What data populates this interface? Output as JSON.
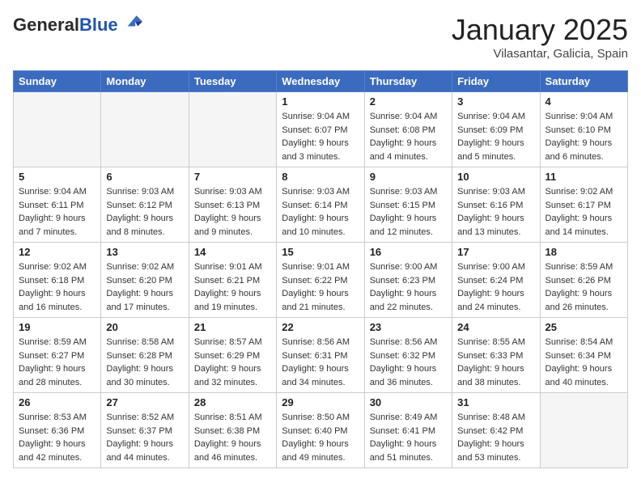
{
  "header": {
    "logo_general": "General",
    "logo_blue": "Blue",
    "month_title": "January 2025",
    "location": "Vilasantar, Galicia, Spain"
  },
  "columns": [
    "Sunday",
    "Monday",
    "Tuesday",
    "Wednesday",
    "Thursday",
    "Friday",
    "Saturday"
  ],
  "weeks": [
    {
      "days": [
        {
          "num": "",
          "info": "",
          "empty": true
        },
        {
          "num": "",
          "info": "",
          "empty": true
        },
        {
          "num": "",
          "info": "",
          "empty": true
        },
        {
          "num": "1",
          "info": "Sunrise: 9:04 AM\nSunset: 6:07 PM\nDaylight: 9 hours and 3 minutes.",
          "empty": false
        },
        {
          "num": "2",
          "info": "Sunrise: 9:04 AM\nSunset: 6:08 PM\nDaylight: 9 hours and 4 minutes.",
          "empty": false
        },
        {
          "num": "3",
          "info": "Sunrise: 9:04 AM\nSunset: 6:09 PM\nDaylight: 9 hours and 5 minutes.",
          "empty": false
        },
        {
          "num": "4",
          "info": "Sunrise: 9:04 AM\nSunset: 6:10 PM\nDaylight: 9 hours and 6 minutes.",
          "empty": false
        }
      ]
    },
    {
      "days": [
        {
          "num": "5",
          "info": "Sunrise: 9:04 AM\nSunset: 6:11 PM\nDaylight: 9 hours and 7 minutes.",
          "empty": false
        },
        {
          "num": "6",
          "info": "Sunrise: 9:03 AM\nSunset: 6:12 PM\nDaylight: 9 hours and 8 minutes.",
          "empty": false
        },
        {
          "num": "7",
          "info": "Sunrise: 9:03 AM\nSunset: 6:13 PM\nDaylight: 9 hours and 9 minutes.",
          "empty": false
        },
        {
          "num": "8",
          "info": "Sunrise: 9:03 AM\nSunset: 6:14 PM\nDaylight: 9 hours and 10 minutes.",
          "empty": false
        },
        {
          "num": "9",
          "info": "Sunrise: 9:03 AM\nSunset: 6:15 PM\nDaylight: 9 hours and 12 minutes.",
          "empty": false
        },
        {
          "num": "10",
          "info": "Sunrise: 9:03 AM\nSunset: 6:16 PM\nDaylight: 9 hours and 13 minutes.",
          "empty": false
        },
        {
          "num": "11",
          "info": "Sunrise: 9:02 AM\nSunset: 6:17 PM\nDaylight: 9 hours and 14 minutes.",
          "empty": false
        }
      ]
    },
    {
      "days": [
        {
          "num": "12",
          "info": "Sunrise: 9:02 AM\nSunset: 6:18 PM\nDaylight: 9 hours and 16 minutes.",
          "empty": false
        },
        {
          "num": "13",
          "info": "Sunrise: 9:02 AM\nSunset: 6:20 PM\nDaylight: 9 hours and 17 minutes.",
          "empty": false
        },
        {
          "num": "14",
          "info": "Sunrise: 9:01 AM\nSunset: 6:21 PM\nDaylight: 9 hours and 19 minutes.",
          "empty": false
        },
        {
          "num": "15",
          "info": "Sunrise: 9:01 AM\nSunset: 6:22 PM\nDaylight: 9 hours and 21 minutes.",
          "empty": false
        },
        {
          "num": "16",
          "info": "Sunrise: 9:00 AM\nSunset: 6:23 PM\nDaylight: 9 hours and 22 minutes.",
          "empty": false
        },
        {
          "num": "17",
          "info": "Sunrise: 9:00 AM\nSunset: 6:24 PM\nDaylight: 9 hours and 24 minutes.",
          "empty": false
        },
        {
          "num": "18",
          "info": "Sunrise: 8:59 AM\nSunset: 6:26 PM\nDaylight: 9 hours and 26 minutes.",
          "empty": false
        }
      ]
    },
    {
      "days": [
        {
          "num": "19",
          "info": "Sunrise: 8:59 AM\nSunset: 6:27 PM\nDaylight: 9 hours and 28 minutes.",
          "empty": false
        },
        {
          "num": "20",
          "info": "Sunrise: 8:58 AM\nSunset: 6:28 PM\nDaylight: 9 hours and 30 minutes.",
          "empty": false
        },
        {
          "num": "21",
          "info": "Sunrise: 8:57 AM\nSunset: 6:29 PM\nDaylight: 9 hours and 32 minutes.",
          "empty": false
        },
        {
          "num": "22",
          "info": "Sunrise: 8:56 AM\nSunset: 6:31 PM\nDaylight: 9 hours and 34 minutes.",
          "empty": false
        },
        {
          "num": "23",
          "info": "Sunrise: 8:56 AM\nSunset: 6:32 PM\nDaylight: 9 hours and 36 minutes.",
          "empty": false
        },
        {
          "num": "24",
          "info": "Sunrise: 8:55 AM\nSunset: 6:33 PM\nDaylight: 9 hours and 38 minutes.",
          "empty": false
        },
        {
          "num": "25",
          "info": "Sunrise: 8:54 AM\nSunset: 6:34 PM\nDaylight: 9 hours and 40 minutes.",
          "empty": false
        }
      ]
    },
    {
      "days": [
        {
          "num": "26",
          "info": "Sunrise: 8:53 AM\nSunset: 6:36 PM\nDaylight: 9 hours and 42 minutes.",
          "empty": false
        },
        {
          "num": "27",
          "info": "Sunrise: 8:52 AM\nSunset: 6:37 PM\nDaylight: 9 hours and 44 minutes.",
          "empty": false
        },
        {
          "num": "28",
          "info": "Sunrise: 8:51 AM\nSunset: 6:38 PM\nDaylight: 9 hours and 46 minutes.",
          "empty": false
        },
        {
          "num": "29",
          "info": "Sunrise: 8:50 AM\nSunset: 6:40 PM\nDaylight: 9 hours and 49 minutes.",
          "empty": false
        },
        {
          "num": "30",
          "info": "Sunrise: 8:49 AM\nSunset: 6:41 PM\nDaylight: 9 hours and 51 minutes.",
          "empty": false
        },
        {
          "num": "31",
          "info": "Sunrise: 8:48 AM\nSunset: 6:42 PM\nDaylight: 9 hours and 53 minutes.",
          "empty": false
        },
        {
          "num": "",
          "info": "",
          "empty": true
        }
      ]
    }
  ]
}
